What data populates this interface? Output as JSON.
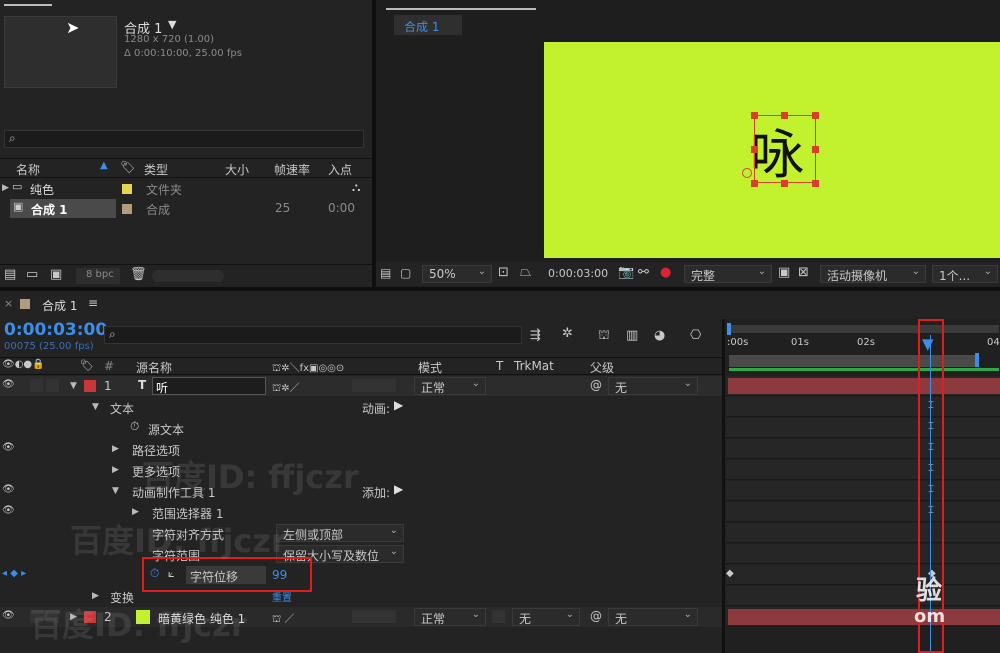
{
  "project": {
    "comp_name": "合成 1",
    "comp_arrow": "▼",
    "resolution": "1280 x 720 (1.00)",
    "duration": "Δ 0:00:10:00, 25.00 fps",
    "search_placeholder": "",
    "columns": [
      "名称",
      "类型",
      "大小",
      "帧速率",
      "入点"
    ],
    "items": [
      {
        "name": "纯色",
        "type": "文件夹",
        "size": "",
        "fps": "",
        "in": "",
        "color": "#e8d44d"
      },
      {
        "name": "合成 1",
        "type": "合成",
        "size": "",
        "fps": "25",
        "in": "0:00",
        "color": "#b19d7e"
      }
    ],
    "bpc": "8 bpc"
  },
  "viewer": {
    "tab": "合成 1",
    "glyph": "咏",
    "bg_color": "#c2f22e",
    "zoom": "50%",
    "timecode": "0:00:03:00",
    "quality": "完整",
    "camera": "活动摄像机",
    "views": "1个..."
  },
  "timeline": {
    "tab": "合成 1",
    "menu_icon": "≡",
    "timecode": "0:00:03:00",
    "frame_info": "00075 (25.00 fps)",
    "headers": {
      "source_name": "源名称",
      "mode": "模式",
      "t": "T",
      "trkmat": "TrkMat",
      "parent": "父级",
      "hash": "#"
    },
    "ruler": [
      ":00s",
      "01s",
      "02s",
      "04"
    ],
    "layer1": {
      "index": "1",
      "type_icon": "T",
      "name": "听",
      "mode": "正常",
      "parent": "无",
      "color": "#c9373a"
    },
    "props": {
      "text": "文本",
      "animate_label": "动画:",
      "source_text": "源文本",
      "path_options": "路径选项",
      "more_options": "更多选项",
      "animator": "动画制作工具 1",
      "add_label": "添加:",
      "range_selector": "范围选择器 1",
      "char_align_label": "字符对齐方式",
      "char_align_value": "左侧或顶部",
      "char_range_label": "字符范围",
      "char_range_value": "保留大小写及数位",
      "char_offset_label": "字符位移",
      "char_offset_value": "99",
      "transform": "变换",
      "reset": "重置"
    },
    "layer2": {
      "index": "2",
      "name": "暗黄绿色 纯色 1",
      "mode": "正常",
      "trkmat": "无",
      "parent": "无",
      "color": "#c9373a",
      "swatch": "#c2f22e"
    }
  },
  "watermark": {
    "line1": "百度ID: ffjczr",
    "line2": "百度ID: ffjczr",
    "line3": "百度ID: ffjczr",
    "corner1": "验",
    "corner2": "om"
  }
}
